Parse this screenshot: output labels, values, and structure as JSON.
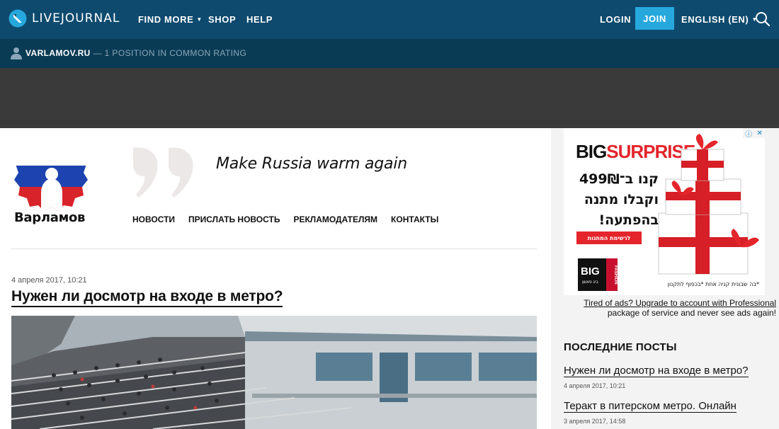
{
  "topbar": {
    "logo_text": "LIVEJOURNAL",
    "nav": [
      {
        "label": "FIND MORE",
        "has_dropdown": true
      },
      {
        "label": "SHOP",
        "has_dropdown": false
      },
      {
        "label": "HELP",
        "has_dropdown": false
      }
    ],
    "login_label": "LOGIN",
    "join_label": "JOIN",
    "language_label": "ENGLISH (EN)",
    "search_icon": "search-icon"
  },
  "subbar": {
    "journal_name": "VARLAMOV.RU",
    "rating_text": "— 1 POSITION IN COMMON RATING"
  },
  "site": {
    "logo_name": "Варламов",
    "slogan": "Make Russia warm again",
    "nav": [
      "НОВОСТИ",
      "ПРИСЛАТЬ НОВОСТЬ",
      "РЕКЛАМОДАТЕЛЯМ",
      "КОНТАКТЫ"
    ]
  },
  "post": {
    "date": "4 апреля 2017, 10:21",
    "title": "Нужен ли досмотр на входе в метро?"
  },
  "ad": {
    "title_big": "BIG",
    "title_surprise": "SURPRISE",
    "hebrew_lines": [
      "קנו ב־499₪",
      "וקבלו מתנה",
      "בהפתעה!"
    ],
    "button_text": "לרשימת המתנות",
    "brand": "BIG",
    "brand_sub": "ביג פאשן",
    "brand_vertical": "FASHION",
    "footnote": "*בה שבונית קניה אחת *בכפוף לתקנון",
    "choices_icons": [
      "adchoices-icon",
      "close-icon"
    ]
  },
  "ad_notice": {
    "link_text": "Tired of ads? Upgrade to account with Professional",
    "rest_text": "package of service and never see ads again!"
  },
  "recent_posts": {
    "heading": "ПОСЛЕДНИЕ ПОСТЫ",
    "items": [
      {
        "title": "Нужен ли досмотр на входе в метро?",
        "date": "4 апреля 2017, 10:21"
      },
      {
        "title": "Теракт в питерском метро. Онлайн",
        "date": "3 апреля 2017, 14:58"
      }
    ]
  },
  "colors": {
    "topbar": "#0d4a6e",
    "subbar": "#0a3b55",
    "join_button": "#26a8dd",
    "banner": "#3a3a3a",
    "ad_red": "#e4252b"
  }
}
